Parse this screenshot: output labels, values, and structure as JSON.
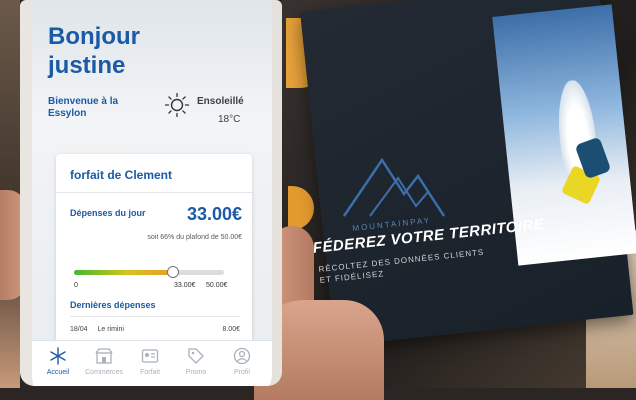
{
  "app": {
    "greeting": "Bonjour justine",
    "welcome": "Bienvenue à la Essylon",
    "weather": {
      "label": "Ensoleillé",
      "temp": "18°C",
      "icon": "sun-icon"
    }
  },
  "card": {
    "title": "forfait de Clement",
    "spend_label": "Dépenses du jour",
    "spend_amount": "33.00€",
    "spend_sub": "soit 66% du plafond de 50.00€",
    "progress": 0.66,
    "tick_min": "0",
    "tick_current": "33.00€",
    "tick_max": "50.00€",
    "recent_title": "Dernières dépenses",
    "recent_items": [
      {
        "date": "18/04",
        "label": "Le rimini",
        "amount": "8.00€"
      }
    ]
  },
  "tabs": [
    {
      "label": "Accueil",
      "icon": "snowflake-icon",
      "active": true
    },
    {
      "label": "Commerces",
      "icon": "shop-icon",
      "active": false
    },
    {
      "label": "Forfait",
      "icon": "pass-icon",
      "active": false
    },
    {
      "label": "Promo",
      "icon": "tag-icon",
      "active": false
    },
    {
      "label": "Profil",
      "icon": "user-icon",
      "active": false
    }
  ],
  "flyer": {
    "brand": "MOUNTAINPAY",
    "headline": "FÉDEREZ VOTRE TERRITOIRE",
    "sub_line1": "RÉCOLTEZ DES DONNÉES CLIENTS",
    "sub_line2": "ET FIDÉLISEZ"
  },
  "colors": {
    "brand_blue": "#1b5aa5",
    "progress_start": "#43b92f",
    "progress_end": "#e89b27"
  }
}
